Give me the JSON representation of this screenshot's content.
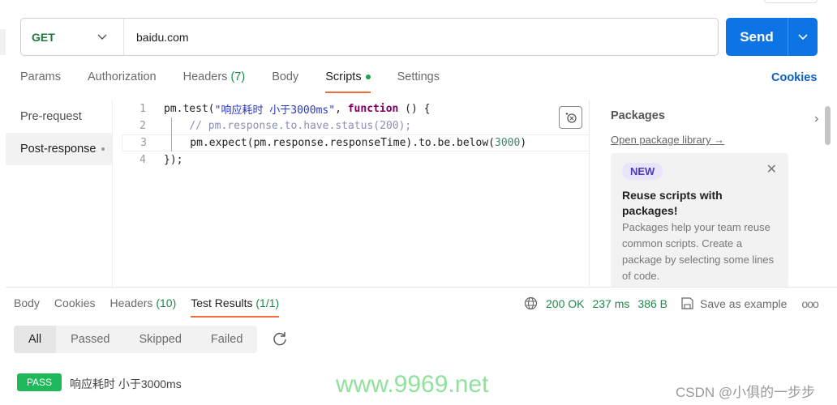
{
  "request": {
    "method": "GET",
    "url": "baidu.com",
    "send_label": "Send"
  },
  "tabs": [
    {
      "label": "Params"
    },
    {
      "label": "Authorization"
    },
    {
      "label": "Headers",
      "count": "(7)"
    },
    {
      "label": "Body"
    },
    {
      "label": "Scripts"
    },
    {
      "label": "Settings"
    }
  ],
  "cookies_link": "Cookies",
  "sidebar": {
    "items": [
      {
        "label": "Pre-request"
      },
      {
        "label": "Post-response"
      }
    ]
  },
  "code": {
    "lines": [
      {
        "n": "1",
        "parts": [
          [
            "",
            "pm.test("
          ],
          [
            "str",
            "\"响应耗时 小于3000ms\""
          ],
          [
            "",
            ", "
          ],
          [
            "kw",
            "function"
          ],
          [
            "",
            " () {"
          ]
        ]
      },
      {
        "n": "2",
        "parts": [
          [
            "",
            "    "
          ],
          [
            "cm",
            "// pm.response.to.have.status(200);"
          ]
        ]
      },
      {
        "n": "3",
        "parts": [
          [
            "",
            "    pm.expect(pm.response.responseTime).to.be.below("
          ],
          [
            "num",
            "3000"
          ],
          [
            "",
            ")"
          ]
        ]
      },
      {
        "n": "4",
        "parts": [
          [
            "",
            "});"
          ]
        ]
      }
    ]
  },
  "packages": {
    "title": "Packages",
    "link": "Open package library →",
    "card": {
      "badge": "NEW",
      "heading": "Reuse scripts with packages!",
      "body": "Packages help your team reuse common scripts. Create a package by selecting some lines of code."
    }
  },
  "response": {
    "tabs": [
      {
        "label": "Body"
      },
      {
        "label": "Cookies"
      },
      {
        "label": "Headers",
        "count": "(10)"
      },
      {
        "label": "Test Results",
        "count": "(1/1)"
      }
    ],
    "status": "200 OK",
    "time": "237 ms",
    "size": "386 B",
    "save_label": "Save as example",
    "more": "ooo",
    "filters": [
      "All",
      "Passed",
      "Skipped",
      "Failed"
    ],
    "results": [
      {
        "badge": "PASS",
        "name": "响应耗时 小于3000ms"
      }
    ]
  },
  "watermarks": {
    "site": "www.9969.net",
    "csdn": "CSDN @小俱的一步步"
  },
  "colors": {
    "accent": "#f26b3a",
    "send": "#0c74e4",
    "pass": "#1fb85a",
    "method": "#1f7a3a"
  }
}
